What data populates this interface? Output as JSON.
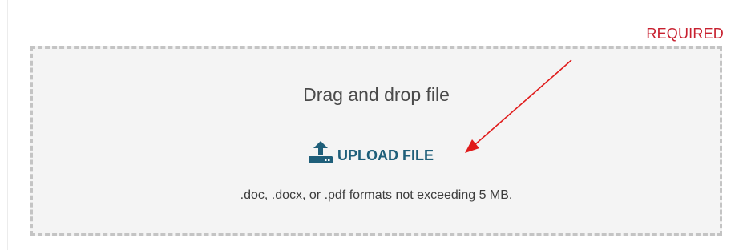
{
  "required_label": "REQUIRED",
  "dropzone": {
    "title": "Drag and drop file",
    "upload_label": "UPLOAD FILE",
    "hint": ".doc, .docx, or .pdf formats not exceeding 5 MB."
  },
  "colors": {
    "required": "#c8202f",
    "link": "#1f5f7a",
    "annotation_arrow": "#e01b1b",
    "dropzone_bg": "#f4f4f4",
    "dropzone_border": "#c4c4c4"
  },
  "icons": {
    "upload": "upload-icon",
    "annotation": "red-arrow"
  }
}
